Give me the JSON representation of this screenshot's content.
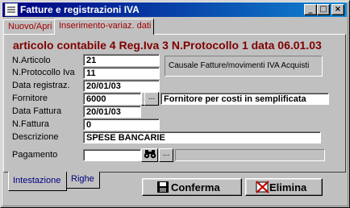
{
  "window": {
    "title": "Fatture e registrazioni IVA"
  },
  "titlebar_buttons": {
    "minimize": "_",
    "maximize": "□",
    "close": "×"
  },
  "top_tabs": [
    {
      "label": "Nuovo/Apri"
    },
    {
      "label": "Inserimento-variaz. dati"
    }
  ],
  "header": "articolo contabile 4 Reg.Iva 3 N.Protocollo 1 data 06.01.03",
  "form": {
    "n_articolo": {
      "label": "N.Articolo",
      "value": "21"
    },
    "n_protocollo": {
      "label": "N.Protocollo Iva",
      "value": "11"
    },
    "data_registrazione": {
      "label": "Data registraz.",
      "value": "20/01/03"
    },
    "fornitore": {
      "label": "Fornitore",
      "value": "6000",
      "name": "Fornitore per costi in semplificata"
    },
    "data_fattura": {
      "label": "Data Fattura",
      "value": "20/01/03"
    },
    "n_fattura": {
      "label": "N.Fattura",
      "value": "0"
    },
    "descrizione": {
      "label": "Descrizione",
      "value": "SPESE BANCARIE"
    },
    "pagamento": {
      "label": "Pagamento",
      "value": "",
      "desc": ""
    },
    "causale": "Causale Fatture/movimenti IVA Acquisti"
  },
  "bottom_tabs": [
    {
      "label": "Intestazione"
    },
    {
      "label": "Righe"
    }
  ],
  "buttons": {
    "confirm": "Conferma",
    "delete": "Elimina"
  },
  "icons": {
    "binoculars": "binoculars-icon",
    "ellipsis": "..."
  }
}
